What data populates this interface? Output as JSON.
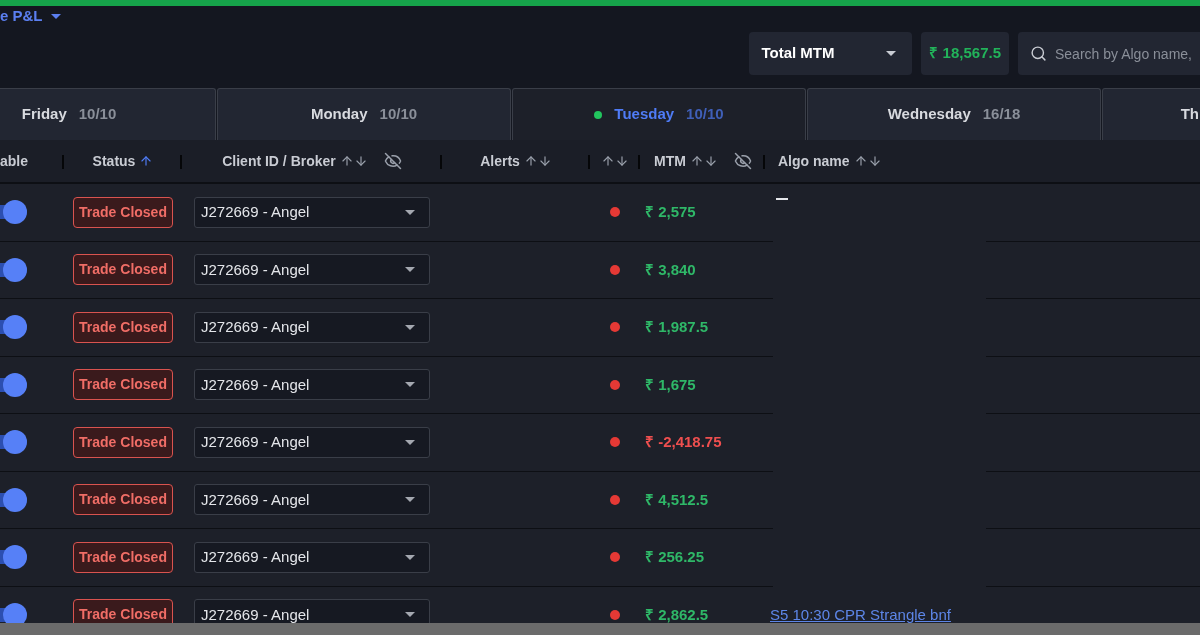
{
  "top_link": {
    "label": "e P&L"
  },
  "toolbar": {
    "metric_select": {
      "value": "Total MTM"
    },
    "total": "₹ 18,567.5",
    "search": {
      "placeholder": "Search by Algo name,"
    }
  },
  "tabs": [
    {
      "day": "Friday",
      "count": "10/10",
      "selected": false
    },
    {
      "day": "Monday",
      "count": "10/10",
      "selected": false
    },
    {
      "day": "Tuesday",
      "count": "10/10",
      "selected": true
    },
    {
      "day": "Wednesday",
      "count": "16/18",
      "selected": false
    },
    {
      "day": "Th",
      "selected": false
    }
  ],
  "table": {
    "columns": [
      {
        "label": "able"
      },
      {
        "label": "Status",
        "sorted": true
      },
      {
        "label": "Client ID / Broker",
        "sorted": false,
        "hidden_toggle": true
      },
      {
        "label": "Alerts",
        "sorted": false
      },
      {
        "sorted": false
      },
      {
        "label": "MTM",
        "sorted": false,
        "hidden_toggle": true
      },
      {
        "label": "Algo name",
        "sorted": false
      }
    ],
    "rows": [
      {
        "enabled": true,
        "status": "Trade Closed",
        "client": "J272669 - Angel",
        "mtm": "₹ 2,575",
        "kind": "profit"
      },
      {
        "enabled": true,
        "status": "Trade Closed",
        "client": "J272669 - Angel",
        "mtm": "₹ 3,840",
        "kind": "profit"
      },
      {
        "enabled": true,
        "status": "Trade Closed",
        "client": "J272669 - Angel",
        "mtm": "₹ 1,987.5",
        "kind": "profit"
      },
      {
        "enabled": true,
        "status": "Trade Closed",
        "client": "J272669 - Angel",
        "mtm": "₹ 1,675",
        "kind": "profit"
      },
      {
        "enabled": true,
        "status": "Trade Closed",
        "client": "J272669 - Angel",
        "mtm": "₹ -2,418.75",
        "kind": "loss"
      },
      {
        "enabled": true,
        "status": "Trade Closed",
        "client": "J272669 - Angel",
        "mtm": "₹ 4,512.5",
        "kind": "profit"
      },
      {
        "enabled": true,
        "status": "Trade Closed",
        "client": "J272669 - Angel",
        "mtm": "₹ 256.25",
        "kind": "profit"
      },
      {
        "enabled": true,
        "status": "Trade Closed",
        "client": "J272669 - Angel",
        "mtm": "₹ 2,862.5",
        "kind": "profit",
        "algo": "S5 10:30 CPR Strangle bnf"
      }
    ]
  }
}
